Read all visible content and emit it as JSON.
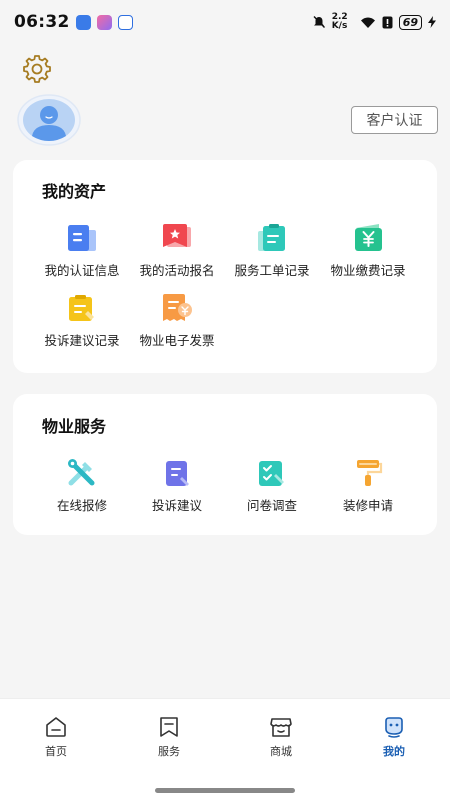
{
  "status_bar": {
    "time": "06:32",
    "network_speed": "2.2 K/s",
    "battery": "69"
  },
  "header": {
    "settings_icon": "gear-icon",
    "avatar_icon": "user-avatar-icon",
    "cert_button": "客户认证"
  },
  "assets": {
    "title": "我的资产",
    "items": [
      {
        "label": "我的认证信息",
        "icon": "certificate-icon",
        "color": "#4a7ef0"
      },
      {
        "label": "我的活动报名",
        "icon": "activity-flag-icon",
        "color": "#f0474f"
      },
      {
        "label": "服务工单记录",
        "icon": "work-order-icon",
        "color": "#2ec8b9"
      },
      {
        "label": "物业缴费记录",
        "icon": "payment-yuan-icon",
        "color": "#25c28f"
      },
      {
        "label": "投诉建议记录",
        "icon": "complaint-record-icon",
        "color": "#f5c419"
      },
      {
        "label": "物业电子发票",
        "icon": "invoice-icon",
        "color": "#f79a44"
      }
    ]
  },
  "services": {
    "title": "物业服务",
    "items": [
      {
        "label": "在线报修",
        "icon": "repair-tools-icon",
        "color": "#2cb8c4"
      },
      {
        "label": "投诉建议",
        "icon": "complaint-edit-icon",
        "color": "#6f73e8"
      },
      {
        "label": "问卷调查",
        "icon": "survey-icon",
        "color": "#2ec8b9"
      },
      {
        "label": "装修申请",
        "icon": "paint-roller-icon",
        "color": "#f5a531"
      }
    ]
  },
  "tabbar": {
    "tabs": [
      {
        "label": "首页",
        "icon": "home-icon",
        "active": false
      },
      {
        "label": "服务",
        "icon": "service-icon",
        "active": false
      },
      {
        "label": "商城",
        "icon": "shop-icon",
        "active": false
      },
      {
        "label": "我的",
        "icon": "profile-robot-icon",
        "active": true
      }
    ],
    "active_color": "#1b5fb3"
  }
}
